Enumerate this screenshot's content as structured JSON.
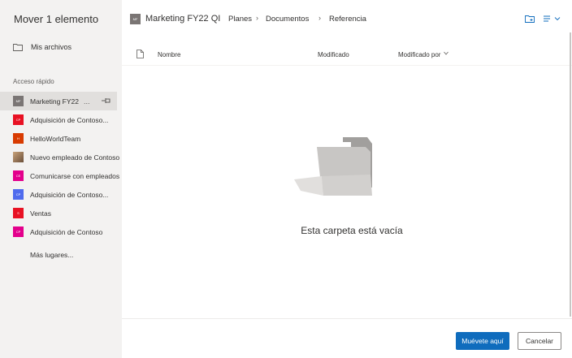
{
  "dialog": {
    "title": "Mover 1 elemento",
    "my_files_label": "Mis archivos",
    "quick_access_label": "Acceso rápido",
    "more_places_label": "Más lugares...",
    "move_button_label": "Muévete aquí",
    "cancel_button_label": "Cancelar"
  },
  "sites": [
    {
      "name": "Marketing FY22",
      "badge": "MF",
      "color": "#7a7574",
      "extra": "...",
      "pinned": true
    },
    {
      "name": "Adquisición de Contoso...",
      "badge": "CP",
      "color": "#e81123"
    },
    {
      "name": "HelloWorldTeam",
      "badge": "H",
      "color": "#d83b01"
    },
    {
      "name": "Nuevo empleado de Contoso",
      "badge": "",
      "color": "#a67c52"
    },
    {
      "name": "Comunicarse con empleados",
      "badge": "CE",
      "color": "#e3008c"
    },
    {
      "name": "Adquisición de Contoso...",
      "badge": "CP",
      "color": "#4f6bed"
    },
    {
      "name": "Ventas",
      "badge": "S",
      "color": "#e81123"
    },
    {
      "name": "Adquisición de Contoso",
      "badge": "CP",
      "color": "#e3008c"
    }
  ],
  "header": {
    "badge": "MF",
    "title": "Marketing FY22 QI",
    "breadcrumbs": [
      "Planes",
      "Documentos",
      "Referencia"
    ]
  },
  "columns": {
    "name": "Nombre",
    "modified": "Modificado",
    "modified_by": "Modificado por"
  },
  "empty_state": {
    "text": "Esta carpeta está vacía"
  },
  "colors": {
    "accent": "#0f6cbd",
    "sidebar_bg": "#f3f2f1"
  }
}
